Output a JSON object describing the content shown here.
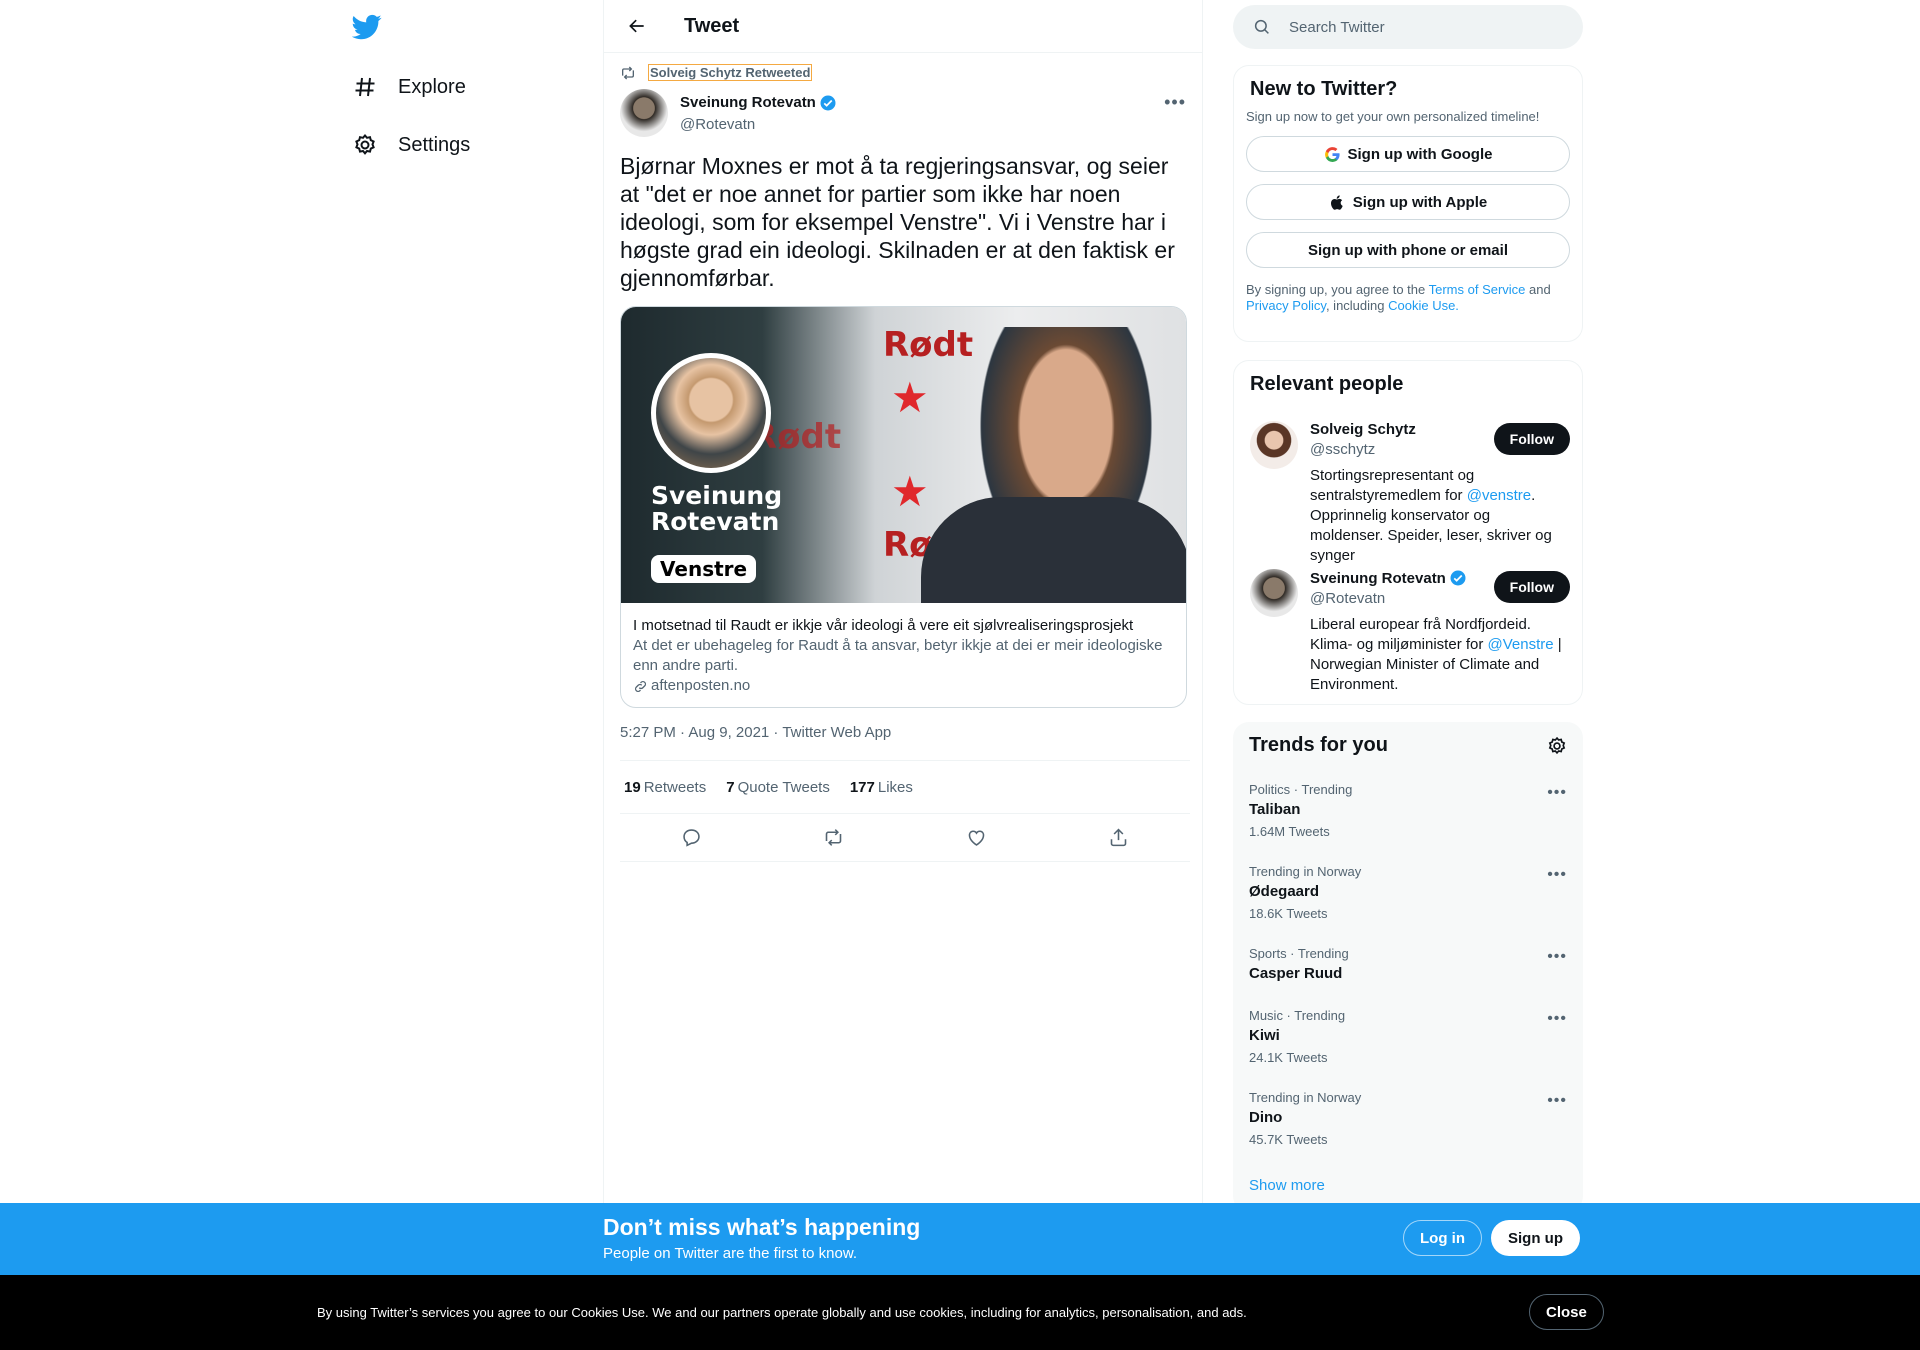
{
  "leftnav": {
    "logo_icon": "twitter-bird-icon",
    "items": [
      {
        "label": "Explore",
        "icon": "hashtag-icon"
      },
      {
        "label": "Settings",
        "icon": "gear-icon"
      }
    ]
  },
  "header": {
    "title": "Tweet"
  },
  "tweet": {
    "retweeted_by": "Solveig Schytz Retweeted",
    "author_name": "Sveinung Rotevatn",
    "author_handle": "@Rotevatn",
    "verified": true,
    "text": "Bjørnar Moxnes er mot å ta regjeringsansvar, og seier at \"det er noe annet for partier som ikke har noen ideologi, som for eksempel Venstre\". Vi i Venstre har i høgste grad ein ideologi. Skilnaden er at den faktisk er gjennomførbar.",
    "card": {
      "image_name": "Sveinung Rotevatn",
      "image_party": "Venstre",
      "image_logo_text": "Rødt",
      "title": "I motsetnad til Raudt er ikkje vår ideologi å vere eit sjølvrealiseringsprosjekt",
      "description": "At det er ubehageleg for Raudt å ta ansvar, betyr ikkje at dei er meir ideologiske enn andre parti.",
      "domain": "aftenposten.no"
    },
    "meta": "5:27 PM · Aug 9, 2021 · Twitter Web App",
    "stats": {
      "retweets_count": "19",
      "retweets_label": "Retweets",
      "quotes_count": "7",
      "quotes_label": "Quote Tweets",
      "likes_count": "177",
      "likes_label": "Likes"
    }
  },
  "search": {
    "placeholder": "Search Twitter"
  },
  "signup": {
    "title": "New to Twitter?",
    "subtitle": "Sign up now to get your own personalized timeline!",
    "google": "Sign up with Google",
    "apple": "Sign up with Apple",
    "phone": "Sign up with phone or email",
    "legal_1": "By signing up, you agree to the ",
    "terms": "Terms of Service",
    "legal_2": " and ",
    "privacy": "Privacy Policy",
    "legal_3": ", including ",
    "cookie": "Cookie Use."
  },
  "people": {
    "title": "Relevant people",
    "list": [
      {
        "name": "Solveig Schytz",
        "handle": "@sschytz",
        "bio_1": "Stortingsrepresentant og sentralstyremedlem for ",
        "bio_link": "@venstre",
        "bio_2": ". Opprinnelig konservator og moldenser. Speider, leser, skriver og synger",
        "follow": "Follow"
      },
      {
        "name": "Sveinung Rotevatn",
        "handle": "@Rotevatn",
        "bio_1": "Liberal europear frå Nordfjordeid. Klima- og miljøminister for ",
        "bio_link": "@Venstre",
        "bio_2": " | Norwegian Minister of Climate and Environment.",
        "follow": "Follow"
      }
    ]
  },
  "trends": {
    "title": "Trends for you",
    "items": [
      {
        "category": "Politics · Trending",
        "topic": "Taliban",
        "count": "1.64M Tweets"
      },
      {
        "category": "Trending in Norway",
        "topic": "Ødegaard",
        "count": "18.6K Tweets"
      },
      {
        "category": "Sports · Trending",
        "topic": "Casper Ruud",
        "count": ""
      },
      {
        "category": "Music · Trending",
        "topic": "Kiwi",
        "count": "24.1K Tweets"
      },
      {
        "category": "Trending in Norway",
        "topic": "Dino",
        "count": "45.7K Tweets"
      }
    ],
    "show_more": "Show more"
  },
  "promo": {
    "title": "Don’t miss what’s happening",
    "subtitle": "People on Twitter are the first to know.",
    "login": "Log in",
    "signup": "Sign up"
  },
  "cookie_bar": {
    "text": "By using Twitter’s services you agree to our Cookies Use. We and our partners operate globally and use cookies, including for analytics, personalisation, and ads.",
    "close": "Close"
  }
}
